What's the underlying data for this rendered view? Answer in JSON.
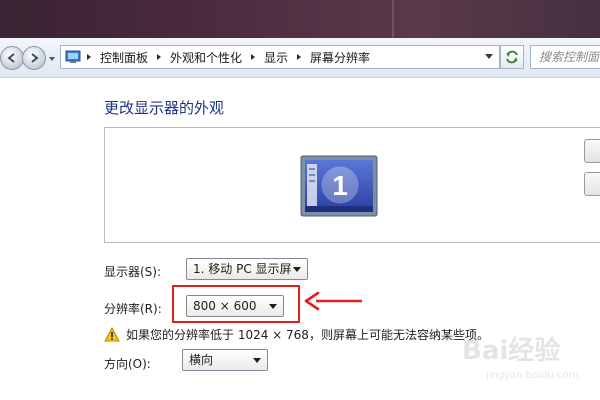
{
  "navigation": {
    "breadcrumbs": [
      "控制面板",
      "外观和个性化",
      "显示",
      "屏幕分辨率"
    ],
    "search_placeholder": "搜索控制面板"
  },
  "page": {
    "title": "更改显示器的外观",
    "monitor_number": "1"
  },
  "settings": {
    "display_label": "显示器(S):",
    "display_value": "1. 移动 PC 显示屏",
    "resolution_label": "分辨率(R):",
    "resolution_value": "800 × 600",
    "warning_text": "如果您的分辨率低于 1024 × 768，则屏幕上可能无法容纳某些项。",
    "orientation_label": "方向(O):",
    "orientation_value": "横向"
  },
  "watermark": {
    "main": "Bai经验",
    "sub": "jingyan.baidu.com"
  },
  "colors": {
    "title": "#1e3287",
    "annotation": "#e0201e"
  },
  "icons": [
    "back-arrow-icon",
    "forward-arrow-icon",
    "control-panel-icon",
    "refresh-icon",
    "monitor-icon",
    "warning-icon",
    "chevron-down-icon"
  ]
}
